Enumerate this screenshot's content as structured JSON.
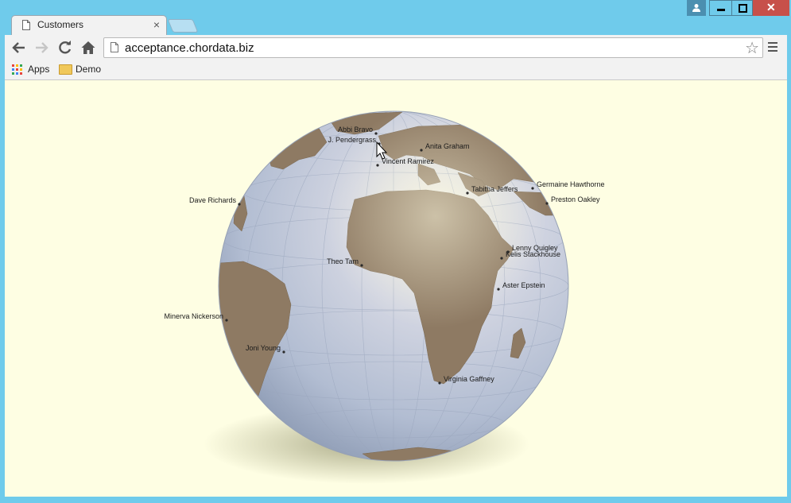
{
  "tab": {
    "title": "Customers"
  },
  "omnibox": {
    "url": "acceptance.chordata.biz"
  },
  "bookmarks": [
    {
      "label": "Apps",
      "icon": "apps-grid-icon"
    },
    {
      "label": "Demo",
      "icon": "folder-icon"
    }
  ],
  "colors": {
    "frame": "#6fcbeb",
    "page_background": "#fefee3",
    "ocean": "#b9c3d6",
    "land": "#8e7a63",
    "close_button": "#c7504a"
  },
  "customers": [
    {
      "name": "Abbi Bravo",
      "anchor": "end"
    },
    {
      "name": "J. Pendergrass",
      "anchor": "end"
    },
    {
      "name": "Anita Graham",
      "anchor": "start"
    },
    {
      "name": "Vincent Ramirez",
      "anchor": "start"
    },
    {
      "name": "Tabitha Jeffers",
      "anchor": "start"
    },
    {
      "name": "Germaine Hawthorne",
      "anchor": "start"
    },
    {
      "name": "Preston Oakley",
      "anchor": "start"
    },
    {
      "name": "Dave Richards",
      "anchor": "end"
    },
    {
      "name": "Lenny Quigley",
      "anchor": "start"
    },
    {
      "name": "Kelis Stackhouse",
      "anchor": "start"
    },
    {
      "name": "Theo Tam",
      "anchor": "end"
    },
    {
      "name": "Aster Epstein",
      "anchor": "start"
    },
    {
      "name": "Minerva Nickerson",
      "anchor": "end"
    },
    {
      "name": "Joni Young",
      "anchor": "end"
    },
    {
      "name": "Virginia Gaffney",
      "anchor": "start"
    }
  ]
}
